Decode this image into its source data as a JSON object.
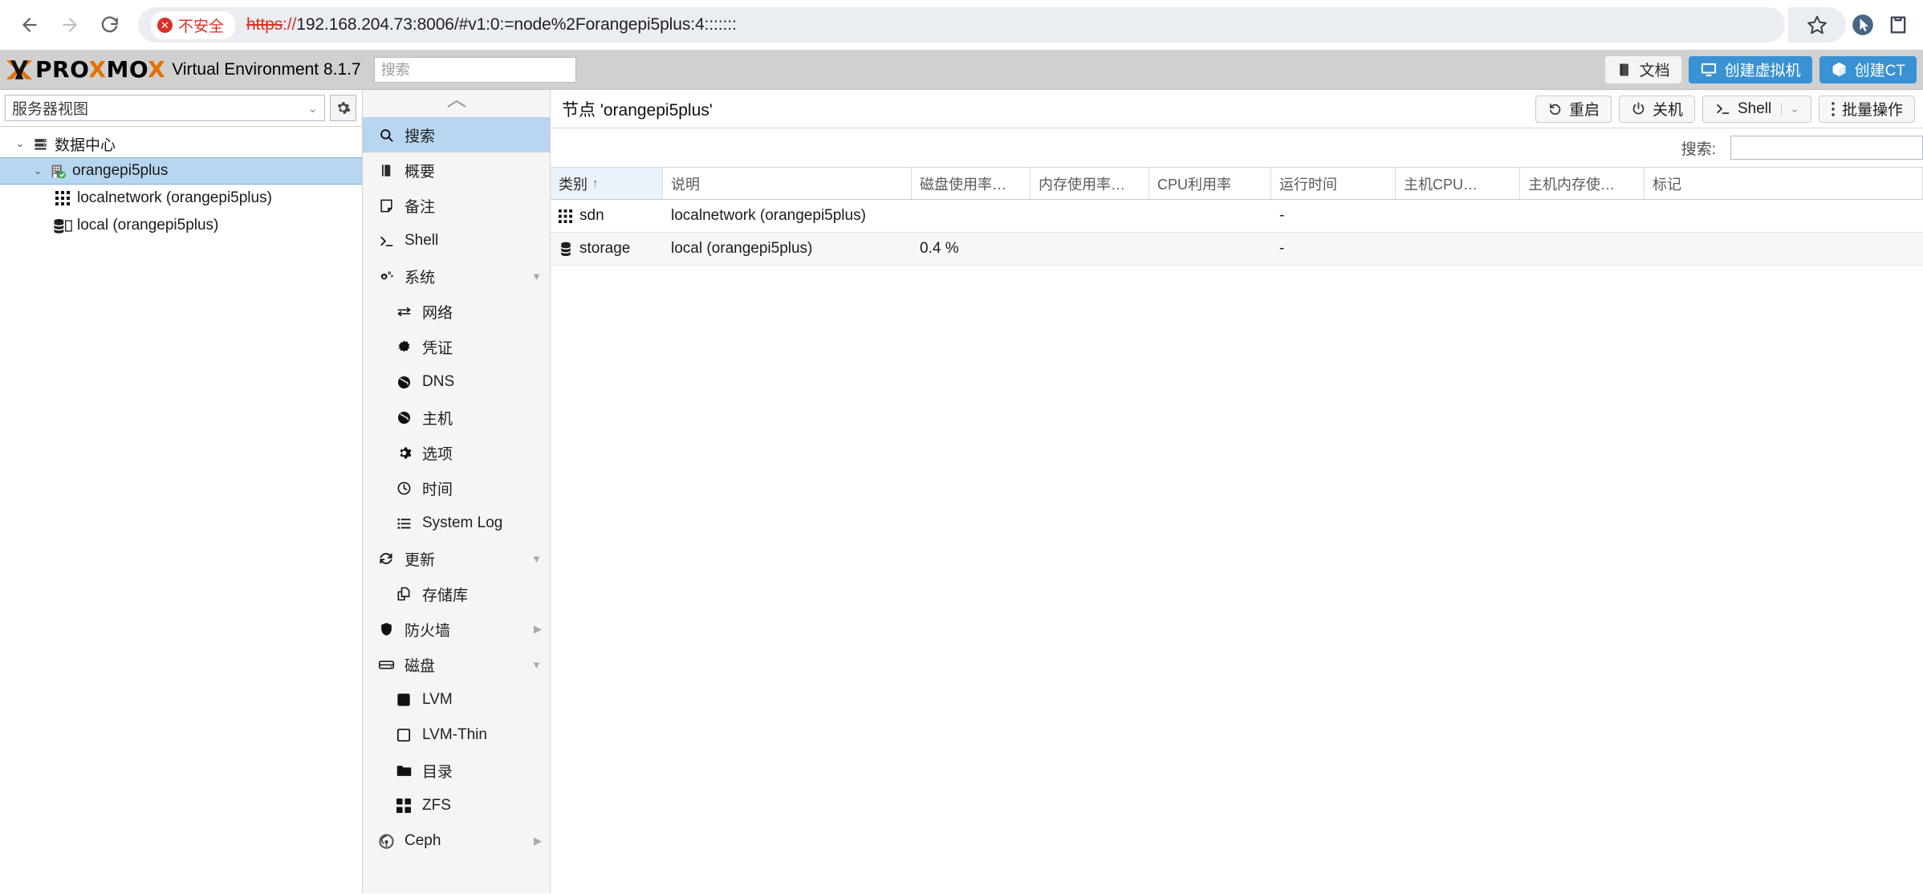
{
  "browser": {
    "back_icon": "arrow-left-icon",
    "forward_icon": "arrow-right-icon",
    "reload_icon": "reload-icon",
    "security_label": "不安全",
    "security_icon": "not-secure-icon",
    "url_scheme": "https",
    "url_separator": "://",
    "url_rest": "192.168.204.73:8006/#v1:0:=node%2Forangepi5plus:4:::::::",
    "bookmark_icon": "star-icon",
    "extension_icon": "cursor-extension-icon",
    "profile_icon": "clipboard-extension-icon"
  },
  "pve_header": {
    "logo_word_pro": "PRO",
    "logo_word_m": "M",
    "logo_word_o": "O",
    "logo_x_tail": "X",
    "product_name": "Virtual Environment 8.1.7",
    "search_placeholder": "搜索",
    "buttons": [
      {
        "label": "文档",
        "icon": "book-icon",
        "style": "light"
      },
      {
        "label": "创建虚拟机",
        "icon": "monitor-icon",
        "style": "blue"
      },
      {
        "label": "创建CT",
        "icon": "cube-icon",
        "style": "blue"
      }
    ]
  },
  "sidebar": {
    "view_selector_value": "服务器视图",
    "view_selector_caret": "chevron-down-icon",
    "gear_icon": "gear-icon",
    "tree": [
      {
        "label": "数据中心",
        "icon": "datacenter-icon",
        "level": 1,
        "expander": "chevron-down-icon",
        "selected": false
      },
      {
        "label": "orangepi5plus",
        "icon": "node-online-icon",
        "level": 2,
        "expander": "chevron-down-icon",
        "selected": true
      },
      {
        "label": "localnetwork (orangepi5plus)",
        "icon": "sdn-grid-icon",
        "level": 3,
        "expander": "",
        "selected": false
      },
      {
        "label": "local (orangepi5plus)",
        "icon": "storage-icon",
        "level": 3,
        "expander": "",
        "selected": false
      }
    ]
  },
  "nav": {
    "collapse_icon": "chevron-up-icon",
    "items": [
      {
        "label": "搜索",
        "icon": "search-icon",
        "level": 0,
        "active": true,
        "expander": ""
      },
      {
        "label": "概要",
        "icon": "book-icon",
        "level": 0,
        "active": false,
        "expander": ""
      },
      {
        "label": "备注",
        "icon": "note-icon",
        "level": 0,
        "active": false,
        "expander": ""
      },
      {
        "label": "Shell",
        "icon": "terminal-icon",
        "level": 0,
        "active": false,
        "expander": ""
      },
      {
        "label": "系统",
        "icon": "gears-icon",
        "level": 0,
        "active": false,
        "expander": "caret-down-icon"
      },
      {
        "label": "网络",
        "icon": "network-icon",
        "level": 1,
        "active": false,
        "expander": ""
      },
      {
        "label": "凭证",
        "icon": "certificate-icon",
        "level": 1,
        "active": false,
        "expander": ""
      },
      {
        "label": "DNS",
        "icon": "globe-icon",
        "level": 1,
        "active": false,
        "expander": ""
      },
      {
        "label": "主机",
        "icon": "globe-icon",
        "level": 1,
        "active": false,
        "expander": ""
      },
      {
        "label": "选项",
        "icon": "gear-icon",
        "level": 1,
        "active": false,
        "expander": ""
      },
      {
        "label": "时间",
        "icon": "clock-icon",
        "level": 1,
        "active": false,
        "expander": ""
      },
      {
        "label": "System Log",
        "icon": "list-icon",
        "level": 1,
        "active": false,
        "expander": ""
      },
      {
        "label": "更新",
        "icon": "refresh-icon",
        "level": 0,
        "active": false,
        "expander": "caret-down-icon"
      },
      {
        "label": "存储库",
        "icon": "repository-icon",
        "level": 1,
        "active": false,
        "expander": ""
      },
      {
        "label": "防火墙",
        "icon": "shield-icon",
        "level": 0,
        "active": false,
        "expander": "caret-right-icon"
      },
      {
        "label": "磁盘",
        "icon": "disk-icon",
        "level": 0,
        "active": false,
        "expander": "caret-down-icon"
      },
      {
        "label": "LVM",
        "icon": "square-filled-icon",
        "level": 1,
        "active": false,
        "expander": ""
      },
      {
        "label": "LVM-Thin",
        "icon": "square-outline-icon",
        "level": 1,
        "active": false,
        "expander": ""
      },
      {
        "label": "目录",
        "icon": "folder-icon",
        "level": 1,
        "active": false,
        "expander": ""
      },
      {
        "label": "ZFS",
        "icon": "grid-four-icon",
        "level": 1,
        "active": false,
        "expander": ""
      },
      {
        "label": "Ceph",
        "icon": "ceph-icon",
        "level": 0,
        "active": false,
        "expander": "caret-right-icon"
      }
    ]
  },
  "content": {
    "title": "节点 'orangepi5plus'",
    "actions": [
      {
        "label": "重启",
        "icon": "restart-icon",
        "split": ""
      },
      {
        "label": "关机",
        "icon": "power-icon",
        "split": ""
      },
      {
        "label": "Shell",
        "icon": "terminal-icon",
        "split": "chevron-down-icon"
      },
      {
        "label": "批量操作",
        "icon": "kebab-icon",
        "split": ""
      }
    ],
    "search_label": "搜索:",
    "search_value": "",
    "columns": [
      {
        "key": "type",
        "label": "类别",
        "sorted": true,
        "sort_arrow": "↑",
        "cls": "c-type"
      },
      {
        "key": "desc",
        "label": "说明",
        "sorted": false,
        "sort_arrow": "",
        "cls": "c-desc"
      },
      {
        "key": "disk",
        "label": "磁盘使用率…",
        "sorted": false,
        "sort_arrow": "",
        "cls": "c-disk"
      },
      {
        "key": "mem",
        "label": "内存使用率…",
        "sorted": false,
        "sort_arrow": "",
        "cls": "c-mem"
      },
      {
        "key": "cpu",
        "label": "CPU利用率",
        "sorted": false,
        "sort_arrow": "",
        "cls": "c-cpu"
      },
      {
        "key": "up",
        "label": "运行时间",
        "sorted": false,
        "sort_arrow": "",
        "cls": "c-up"
      },
      {
        "key": "hcpu",
        "label": "主机CPU…",
        "sorted": false,
        "sort_arrow": "",
        "cls": "c-hcpu"
      },
      {
        "key": "hmem",
        "label": "主机内存使…",
        "sorted": false,
        "sort_arrow": "",
        "cls": "c-hmem"
      },
      {
        "key": "tag",
        "label": "标记",
        "sorted": false,
        "sort_arrow": "",
        "cls": "c-tag"
      }
    ],
    "rows": [
      {
        "icon": "sdn-grid-icon",
        "type": "sdn",
        "desc": "localnetwork (orangepi5plus)",
        "disk": "",
        "mem": "",
        "cpu": "",
        "up": "-",
        "hcpu": "",
        "hmem": "",
        "tag": ""
      },
      {
        "icon": "storage-icon",
        "type": "storage",
        "desc": "local (orangepi5plus)",
        "disk": "0.4 %",
        "mem": "",
        "cpu": "",
        "up": "-",
        "hcpu": "",
        "hmem": "",
        "tag": ""
      }
    ]
  },
  "colors": {
    "brand_orange": "#e57000",
    "accent_blue": "#3892d4",
    "selection_blue": "#b8d6ef",
    "insecure_red": "#d93025",
    "header_grey": "#d0d0d0"
  }
}
